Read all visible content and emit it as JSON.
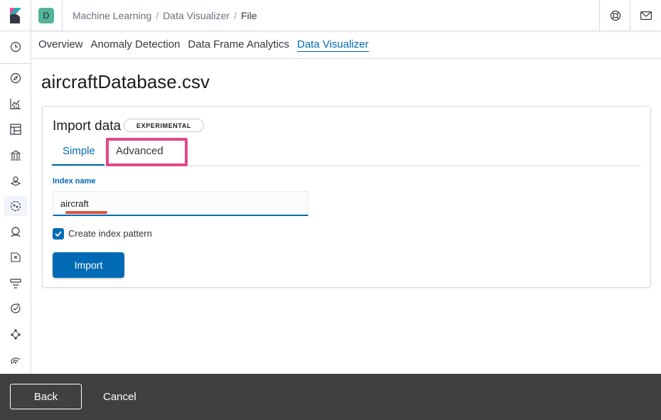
{
  "header": {
    "space_initial": "D",
    "breadcrumbs": [
      "Machine Learning",
      "Data Visualizer",
      "File"
    ]
  },
  "app_tabs": [
    "Overview",
    "Anomaly Detection",
    "Data Frame Analytics",
    "Data Visualizer"
  ],
  "page": {
    "title": "aircraftDatabase.csv"
  },
  "import_panel": {
    "title": "Import data",
    "badge": "EXPERIMENTAL",
    "tabs": [
      "Simple",
      "Advanced"
    ],
    "index_name_label": "Index name",
    "index_name_value": "aircraft",
    "create_index_pattern_label": "Create index pattern",
    "create_index_pattern_checked": true,
    "import_button": "Import"
  },
  "bottom_bar": {
    "back_label": "Back",
    "cancel_label": "Cancel"
  },
  "colors": {
    "accent": "#006bb4",
    "highlight": "#e2478b",
    "space_avatar": "#54b399",
    "bottom_bar": "#404040"
  }
}
